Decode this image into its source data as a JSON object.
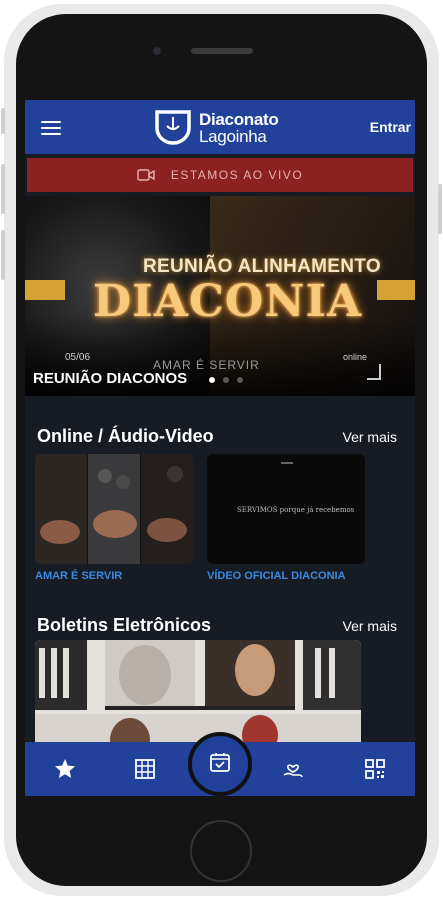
{
  "header": {
    "logo_line1": "Diaconato",
    "logo_line2": "Lagoinha",
    "login_label": "Entrar"
  },
  "live_bar": {
    "label": "ESTAMOS AO VIVO"
  },
  "banner": {
    "subtitle": "REUNIÃO ALINHAMENTO",
    "headline": "DIACONIA",
    "date": "05/06",
    "tagline": "AMAR É SERVIR",
    "online": "online",
    "caption": "REUNIÃO DIACONOS"
  },
  "sections": {
    "online": {
      "title": "Online / Áudio-Video",
      "see_more": "Ver mais",
      "cards": [
        {
          "label": "AMAR É SERVIR"
        },
        {
          "label": "VÍDEO OFICIAL DIACONIA",
          "overlay": "SERVIMOS porque já recebemos"
        }
      ]
    },
    "bulletins": {
      "title": "Boletins Eletrônicos",
      "see_more": "Ver mais"
    }
  },
  "bottom_nav": {
    "items": [
      "star-icon",
      "grid-icon",
      "calendar-check-icon",
      "hand-heart-icon",
      "qr-code-icon"
    ]
  },
  "colors": {
    "brand_blue": "#22419a",
    "live_red": "#8c2121",
    "accent_gold": "#d7a235",
    "link_blue": "#3a8be0",
    "screen_bg": "#171b24"
  }
}
